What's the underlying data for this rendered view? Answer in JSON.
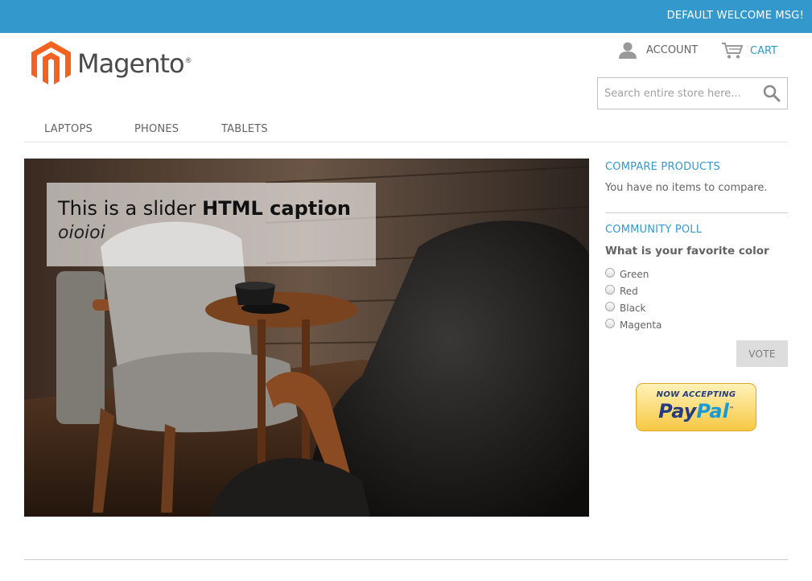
{
  "header": {
    "welcome": "DEFAULT WELCOME MSG!",
    "logo_text": "Magento",
    "logo_reg": "®",
    "account_label": "ACCOUNT",
    "cart_label": "CART",
    "search_placeholder": "Search entire store here...",
    "accent_color": "#3399cc",
    "logo_color": "#f26322"
  },
  "nav": {
    "items": [
      {
        "label": "LAPTOPS"
      },
      {
        "label": "PHONES"
      },
      {
        "label": "TABLETS"
      }
    ]
  },
  "slider": {
    "caption_prefix": "This is a slider ",
    "caption_bold": "HTML caption",
    "caption_italic": "oioioi"
  },
  "sidebar": {
    "compare": {
      "title": "COMPARE PRODUCTS",
      "text": "You have no items to compare."
    },
    "poll": {
      "title": "COMMUNITY POLL",
      "question": "What is your favorite color",
      "options": [
        {
          "label": "Green"
        },
        {
          "label": "Red"
        },
        {
          "label": "Black"
        },
        {
          "label": "Magenta"
        }
      ],
      "vote_label": "VOTE"
    },
    "paypal": {
      "now_accepting": "NOW ACCEPTING",
      "pay": "Pay",
      "pal": "Pal",
      "tm": "™"
    }
  },
  "icons": {
    "account": "user-icon",
    "cart": "cart-icon",
    "search": "search-icon",
    "logo": "magento-logo-icon"
  }
}
